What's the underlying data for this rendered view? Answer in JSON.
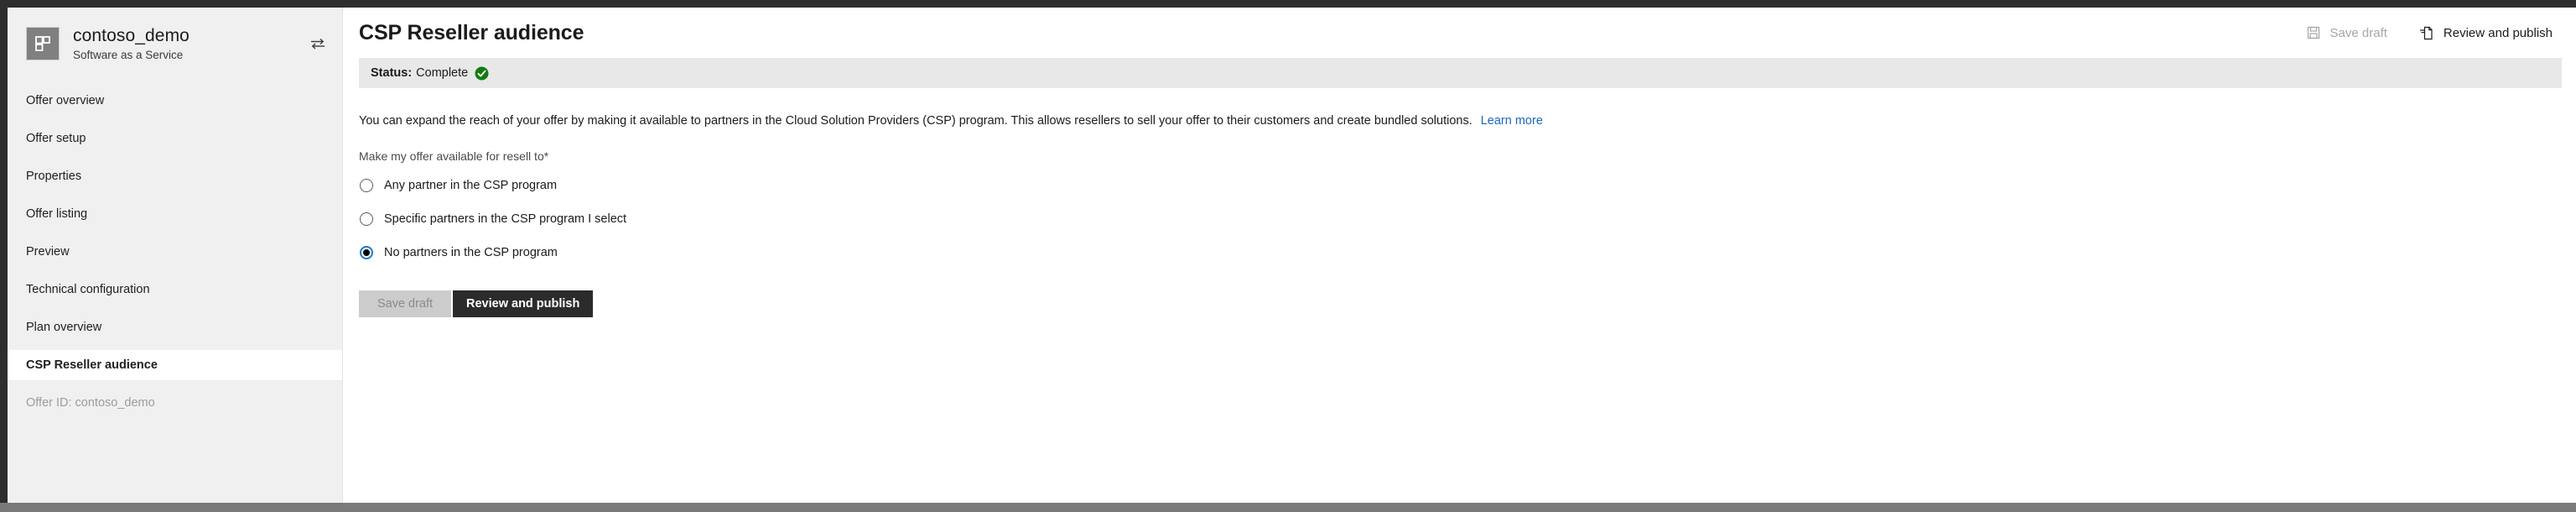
{
  "colors": {
    "accent_blue": "#1a7ad4",
    "link_blue": "#1a66c2",
    "status_green": "#107c10",
    "chrome_dark": "#2e2e2e",
    "sidebar_bg": "#f0f0f0",
    "status_bar_bg": "#e8e8e8",
    "primary_button_bg": "#2b2b2b",
    "secondary_button_bg": "#cccccc"
  },
  "sidebar": {
    "app_icon_name": "offer-grid-icon",
    "app_title": "contoso_demo",
    "app_subtitle": "Software as a Service",
    "switch_icon_name": "switch-arrows-icon",
    "items": [
      {
        "label": "Offer overview",
        "selected": false
      },
      {
        "label": "Offer setup",
        "selected": false
      },
      {
        "label": "Properties",
        "selected": false
      },
      {
        "label": "Offer listing",
        "selected": false
      },
      {
        "label": "Preview",
        "selected": false
      },
      {
        "label": "Technical configuration",
        "selected": false
      },
      {
        "label": "Plan overview",
        "selected": false
      },
      {
        "label": "CSP Reseller audience",
        "selected": true
      }
    ],
    "footer_label": "Offer ID: contoso_demo"
  },
  "commandbar": {
    "page_title": "CSP Reseller audience",
    "save_draft_label": "Save draft",
    "save_draft_icon": "save-floppy-icon",
    "save_draft_disabled": true,
    "review_publish_label": "Review and publish",
    "review_publish_icon": "publish-document-icon"
  },
  "status": {
    "label": "Status:",
    "value": "Complete",
    "icon_name": "check-circle-icon"
  },
  "main": {
    "intro_text": "You can expand the reach of your offer by making it available to partners in the Cloud Solution Providers (CSP) program. This allows resellers to sell your offer to their customers and create bundled solutions.",
    "learn_more_label": "Learn more",
    "field_label": "Make my offer available for resell to*",
    "radio_options": [
      {
        "label": "Any partner in the CSP program",
        "checked": false
      },
      {
        "label": "Specific partners in the CSP program I select",
        "checked": false
      },
      {
        "label": "No partners in the CSP program",
        "checked": true
      }
    ],
    "save_draft_label": "Save draft",
    "review_publish_label": "Review and publish"
  }
}
